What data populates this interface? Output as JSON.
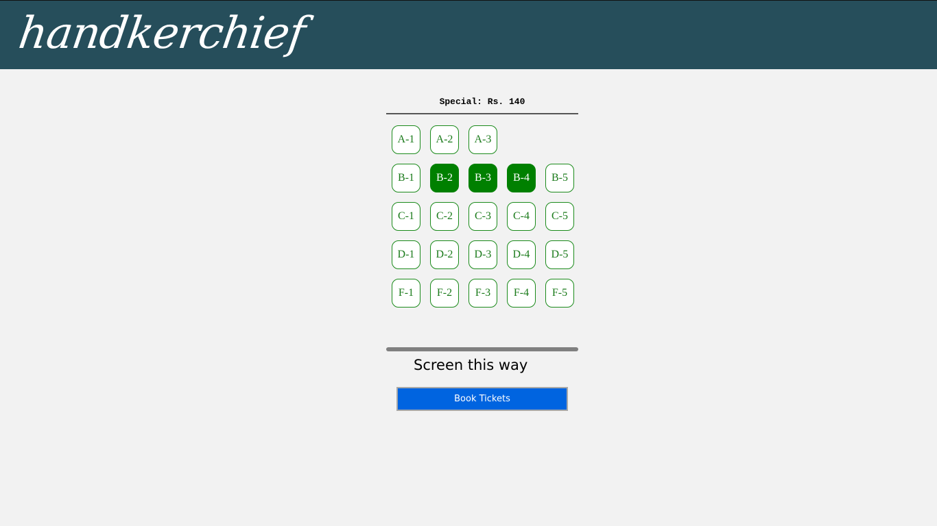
{
  "header": {
    "logo_text": "handkerchief",
    "background_color": "#264e5b"
  },
  "section": {
    "title": "Special: Rs. 140"
  },
  "seats": {
    "rows": [
      [
        {
          "label": "A-1",
          "selected": false
        },
        {
          "label": "A-2",
          "selected": false
        },
        {
          "label": "A-3",
          "selected": false
        },
        {
          "label": "",
          "selected": false
        },
        {
          "label": "",
          "selected": false
        }
      ],
      [
        {
          "label": "B-1",
          "selected": false
        },
        {
          "label": "B-2",
          "selected": true
        },
        {
          "label": "B-3",
          "selected": true
        },
        {
          "label": "B-4",
          "selected": true
        },
        {
          "label": "B-5",
          "selected": false
        }
      ],
      [
        {
          "label": "C-1",
          "selected": false
        },
        {
          "label": "C-2",
          "selected": false
        },
        {
          "label": "C-3",
          "selected": false
        },
        {
          "label": "C-4",
          "selected": false
        },
        {
          "label": "C-5",
          "selected": false
        }
      ],
      [
        {
          "label": "D-1",
          "selected": false
        },
        {
          "label": "D-2",
          "selected": false
        },
        {
          "label": "D-3",
          "selected": false
        },
        {
          "label": "D-4",
          "selected": false
        },
        {
          "label": "D-5",
          "selected": false
        }
      ],
      [
        {
          "label": "F-1",
          "selected": false
        },
        {
          "label": "F-2",
          "selected": false
        },
        {
          "label": "F-3",
          "selected": false
        },
        {
          "label": "F-4",
          "selected": false
        },
        {
          "label": "F-5",
          "selected": false
        }
      ]
    ],
    "available_color": "#1a8a1a",
    "selected_color": "#008000"
  },
  "screen": {
    "label": "Screen this way"
  },
  "actions": {
    "book_label": "Book Tickets",
    "book_color": "#0064e0"
  }
}
